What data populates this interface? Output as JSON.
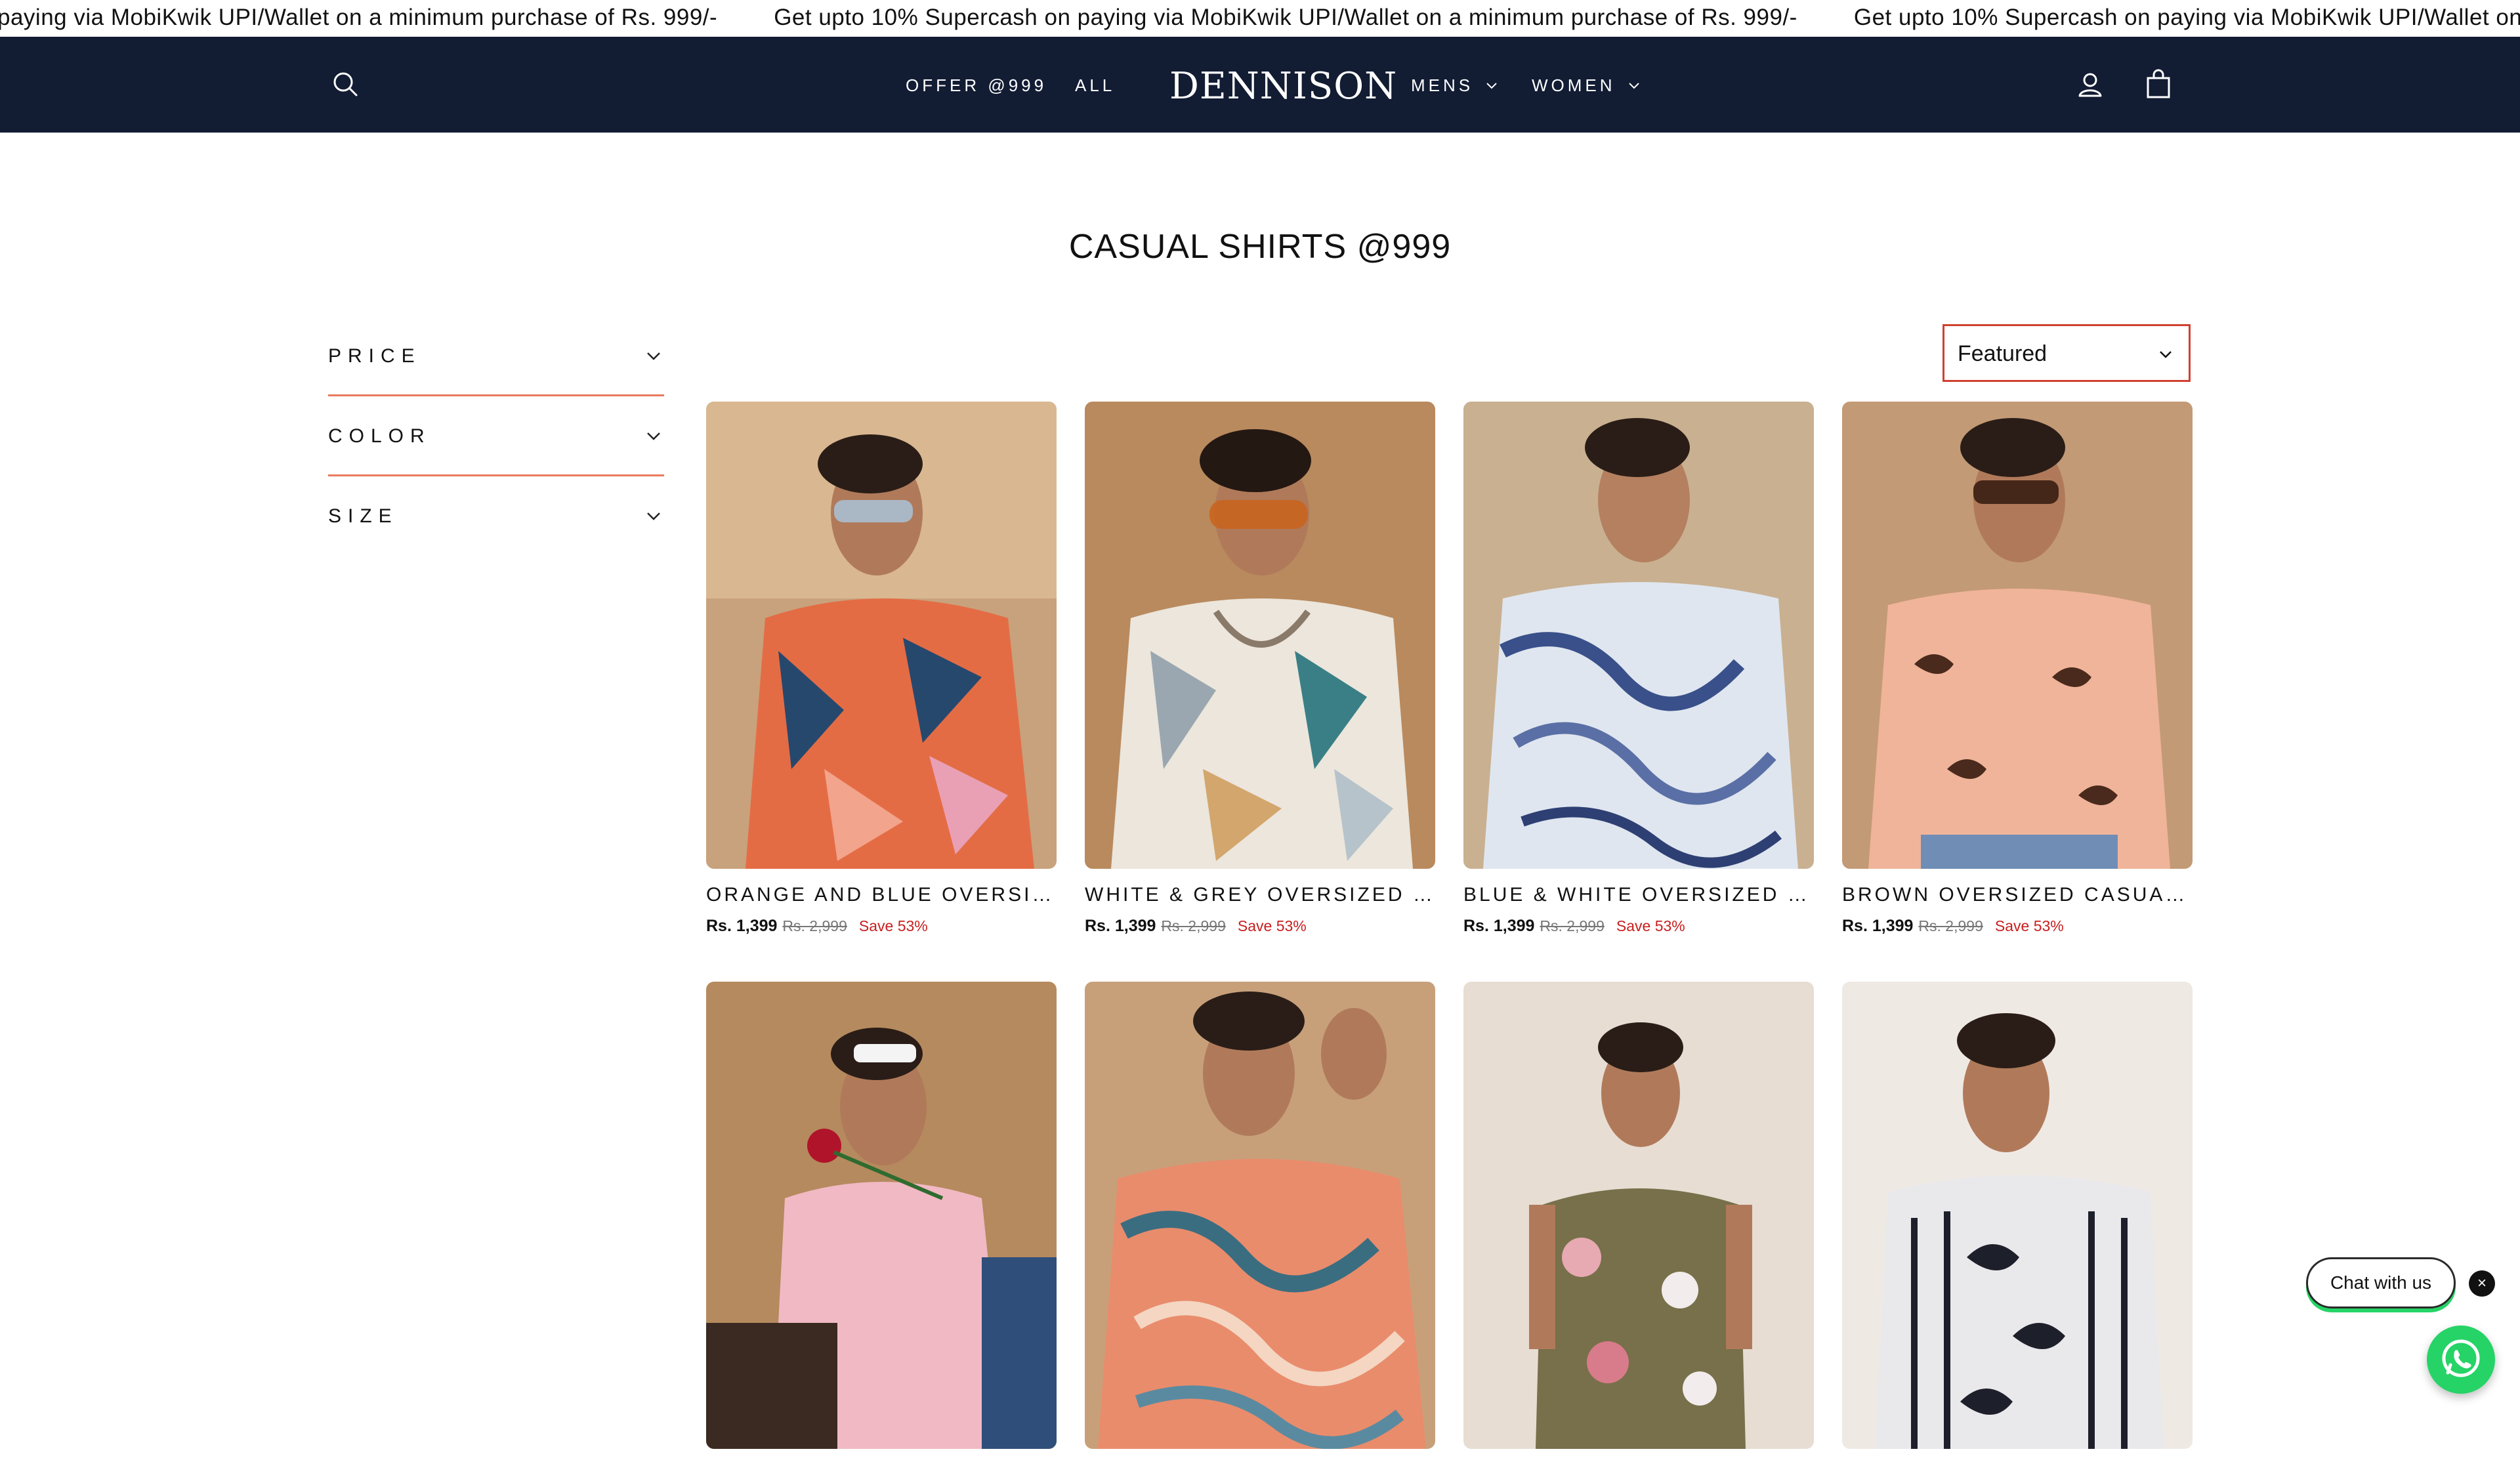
{
  "announcement": {
    "items": [
      "paying via MobiKwik UPI/Wallet on a minimum purchase of Rs. 999/-",
      "Get upto 10% Supercash on paying via MobiKwik UPI/Wallet on a minimum purchase of Rs. 999/-",
      "Get upto 10% Supercash on paying via MobiKwik UPI/Wallet on"
    ]
  },
  "header": {
    "logo": "DENNISON",
    "nav_left": [
      {
        "label": "OFFER @999"
      },
      {
        "label": "ALL"
      }
    ],
    "nav_right": [
      {
        "label": "MENS"
      },
      {
        "label": "WOMEN"
      }
    ],
    "icons": [
      "search-icon",
      "account-icon",
      "cart-icon"
    ]
  },
  "page": {
    "title": "CASUAL SHIRTS @999"
  },
  "filters": [
    {
      "label": "PRICE"
    },
    {
      "label": "COLOR"
    },
    {
      "label": "SIZE"
    }
  ],
  "sort": {
    "selected": "Featured"
  },
  "products": [
    {
      "name": "ORANGE AND BLUE OVERSIZED CASUAL SHIRT",
      "price": "Rs. 1,399",
      "compare_price": "Rs. 2,999",
      "save": "Save 53%"
    },
    {
      "name": "WHITE & GREY OVERSIZED CASUAL SHIRT",
      "price": "Rs. 1,399",
      "compare_price": "Rs. 2,999",
      "save": "Save 53%"
    },
    {
      "name": "BLUE & WHITE OVERSIZED CASUAL SHIRT",
      "price": "Rs. 1,399",
      "compare_price": "Rs. 2,999",
      "save": "Save 53%"
    },
    {
      "name": "BROWN OVERSIZED CASUAL SHIRT",
      "price": "Rs. 1,399",
      "compare_price": "Rs. 2,999",
      "save": "Save 53%"
    },
    {
      "name": "",
      "price": "",
      "compare_price": "",
      "save": ""
    },
    {
      "name": "",
      "price": "",
      "compare_price": "",
      "save": ""
    },
    {
      "name": "",
      "price": "",
      "compare_price": "",
      "save": ""
    },
    {
      "name": "",
      "price": "",
      "compare_price": "",
      "save": ""
    }
  ],
  "chat": {
    "label": "Chat with us",
    "close": "×"
  },
  "colors": {
    "header_bg": "#121c33",
    "filter_rule": "#e87a5d",
    "sort_border": "#d0412f",
    "save_red": "#c81e1e",
    "whatsapp_green": "#25d366"
  }
}
